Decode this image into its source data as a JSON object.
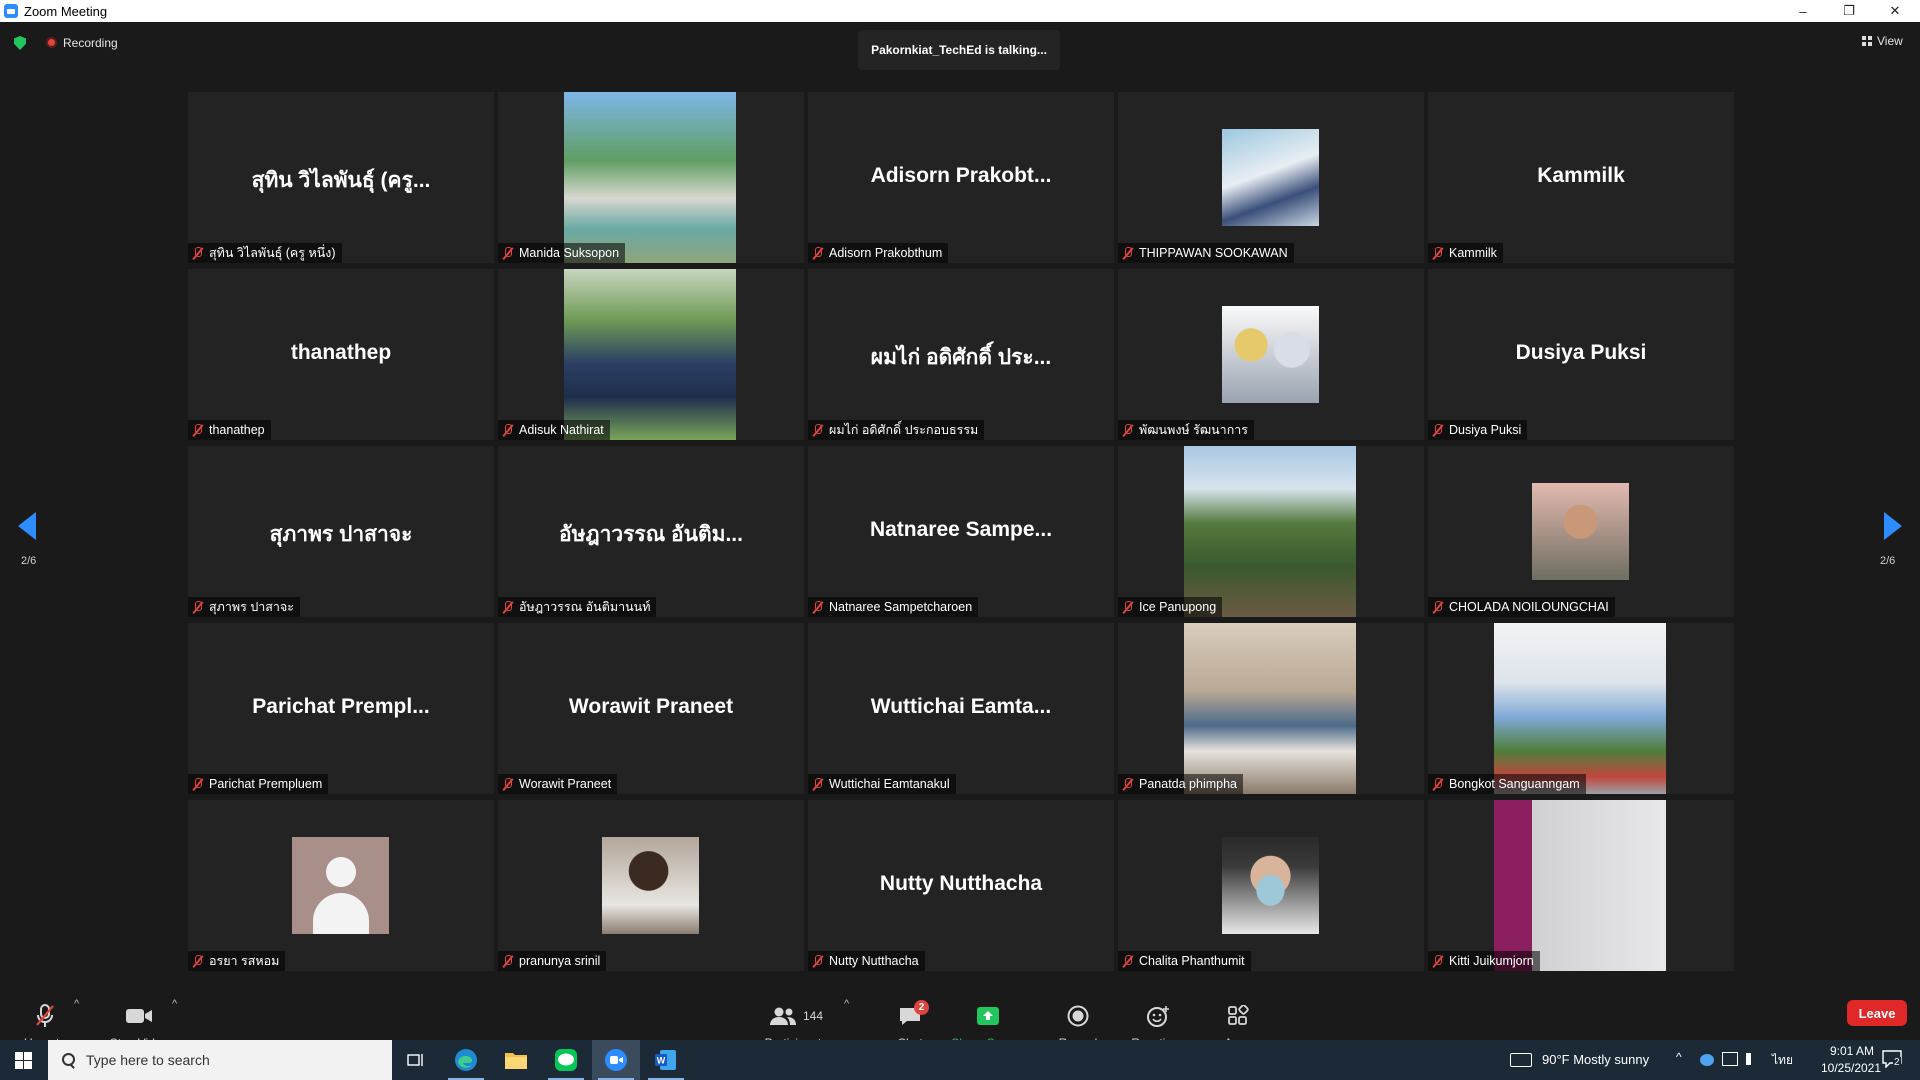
{
  "window": {
    "title": "Zoom Meeting",
    "minimize": "–",
    "restore": "❐",
    "close": "✕"
  },
  "topbar": {
    "recording": "Recording",
    "talking": "Pakornkiat_TechEd is talking...",
    "view": "View"
  },
  "pager": {
    "left": "2/6",
    "right": "2/6"
  },
  "tiles": [
    {
      "big": "สุทิน วิไลพันธุ์ (ครู...",
      "label": "สุทิน วิไลพันธุ์ (ครู หนึ่ง)"
    },
    {
      "label": "Manida Suksopon"
    },
    {
      "big": "Adisorn  Prakobt...",
      "label": "Adisorn Prakobthum"
    },
    {
      "label": "THIPPAWAN SOOKAWAN"
    },
    {
      "big": "Kammilk",
      "label": "Kammilk"
    },
    {
      "big": "thanathep",
      "label": "thanathep"
    },
    {
      "label": "Adisuk Nathirat"
    },
    {
      "big": "ผมไก่ อดิศักดิ์ ประ...",
      "label": "ผมไก่ อดิศักดิ์ ประกอบธรรม"
    },
    {
      "label": "พัฒนพงษ์ รัฒนาการ"
    },
    {
      "big": "Dusiya Puksi",
      "label": "Dusiya Puksi"
    },
    {
      "big": "สุภาพร ปาสาจะ",
      "label": "สุภาพร ปาสาจะ"
    },
    {
      "big": "อัษฎาวรรณ อันติม...",
      "label": "อัษฎาวรรณ อันติมานนท์"
    },
    {
      "big": "Natnaree  Sampe...",
      "label": "Natnaree Sampetcharoen"
    },
    {
      "label": "Ice Panupong"
    },
    {
      "label": "CHOLADA NOILOUNGCHAI"
    },
    {
      "big": "Parichat  Prempl...",
      "label": "Parichat Prempluem"
    },
    {
      "big": "Worawit Praneet",
      "label": "Worawit Praneet"
    },
    {
      "big": "Wuttichai  Eamta...",
      "label": "Wuttichai Eamtanakul"
    },
    {
      "label": "Panatda phimpha"
    },
    {
      "label": "Bongkot Sanguanngam"
    },
    {
      "label": "อรยา รสหอม"
    },
    {
      "label": "pranunya srinil"
    },
    {
      "big": "Nutty Nutthacha",
      "label": "Nutty Nutthacha"
    },
    {
      "label": "Chalita Phanthumit"
    },
    {
      "label": "Kitti Juikumjorn"
    }
  ],
  "toolbar": {
    "unmute": "Unmute",
    "stop_video": "Stop Video",
    "participants": "Participants",
    "participant_count": "144",
    "chat": "Chat",
    "chat_badge": "2",
    "share_screen": "Share Screen",
    "record": "Record",
    "reactions": "Reactions",
    "apps": "Apps",
    "leave": "Leave"
  },
  "taskbar": {
    "search_placeholder": "Type here to search",
    "weather": "90°F  Mostly sunny",
    "lang": "ไทย",
    "time": "9:01 AM",
    "date": "10/25/2021",
    "notif_count": "2"
  },
  "colors": {
    "accent": "#2d8cff",
    "leave": "#e02828",
    "share_green": "#23c55e",
    "muted_red": "#e0443e"
  }
}
